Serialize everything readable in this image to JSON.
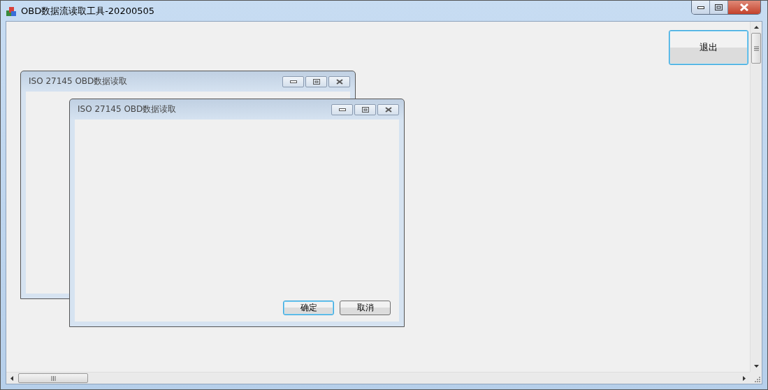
{
  "window": {
    "title": "OBD数据流读取工具-20200505"
  },
  "exit_button": {
    "label": "退出",
    "focused": true
  },
  "child_windows": [
    {
      "title": "ISO 27145 OBD数据读取"
    },
    {
      "title": "ISO 27145 OBD数据读取",
      "buttons": [
        {
          "label": "确定",
          "focused": true
        },
        {
          "label": "取消",
          "focused": false
        }
      ]
    }
  ]
}
